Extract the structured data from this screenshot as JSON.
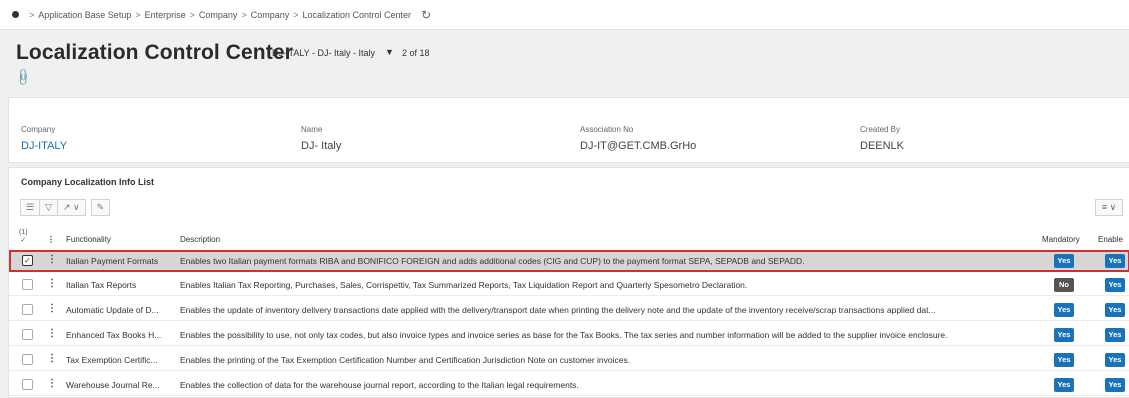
{
  "breadcrumb": {
    "items": [
      "Application Base Setup",
      "Enterprise",
      "Company",
      "Company",
      "Localization Control Center"
    ],
    "separator": ">"
  },
  "header": {
    "title": "Localization Control Center",
    "record_ref": "DJ-ITALY - DJ- Italy - Italy",
    "record_count": "2 of 18"
  },
  "company_card": {
    "company_label": "Company",
    "company_value": "DJ-ITALY",
    "name_label": "Name",
    "name_value": "DJ- Italy",
    "association_label": "Association No",
    "association_value": "DJ-IT@GET.CMB.GrHo",
    "created_by_label": "Created By",
    "created_by_value": "DEENLK"
  },
  "list": {
    "title": "Company Localization Info List",
    "selection_count": "(1)",
    "columns": {
      "functionality": "Functionality",
      "description": "Description",
      "mandatory": "Mandatory",
      "enabled": "Enable"
    },
    "rows": [
      {
        "functionality": "Italian Payment Formats",
        "description": "Enables two Italian payment formats RIBA and BONIFICO FOREIGN and adds additional codes (CIG and CUP) to the payment format SEPA, SEPADB and SEPADD.",
        "mandatory": "Yes",
        "enabled": "Yes",
        "selected": true
      },
      {
        "functionality": "Italian Tax Reports",
        "description": "Enables Italian Tax Reporting, Purchases, Sales, Corrispettiv, Tax Summarized Reports, Tax Liquidation Report and Quarterly Spesometro Declaration.",
        "mandatory": "No",
        "enabled": "Yes",
        "selected": false
      },
      {
        "functionality": "Automatic Update of D...",
        "description": "Enables the update of inventory delivery transactions date applied with the delivery/transport date when printing the delivery note and the update of the inventory receive/scrap transactions applied dat...",
        "mandatory": "Yes",
        "enabled": "Yes",
        "selected": false
      },
      {
        "functionality": "Enhanced Tax Books H...",
        "description": "Enables the possibility to use, not only tax codes, but also invoice types and invoice series as base for the Tax Books. The tax series and number information will be added to the supplier invoice enclosure.",
        "mandatory": "Yes",
        "enabled": "Yes",
        "selected": false
      },
      {
        "functionality": "Tax Exemption Certific...",
        "description": "Enables the printing of the Tax Exemption Certification Number and Certification Jurisdiction Note on customer invoices.",
        "mandatory": "Yes",
        "enabled": "Yes",
        "selected": false
      },
      {
        "functionality": "Warehouse Journal Re...",
        "description": "Enables the collection of data for the warehouse journal report, according to the Italian legal requirements.",
        "mandatory": "Yes",
        "enabled": "Yes",
        "selected": false
      }
    ]
  },
  "colors": {
    "link": "#1a6fb5",
    "badge_yes": "#1a73b8",
    "badge_no": "#555555",
    "selection_outline": "#d32f2f"
  }
}
